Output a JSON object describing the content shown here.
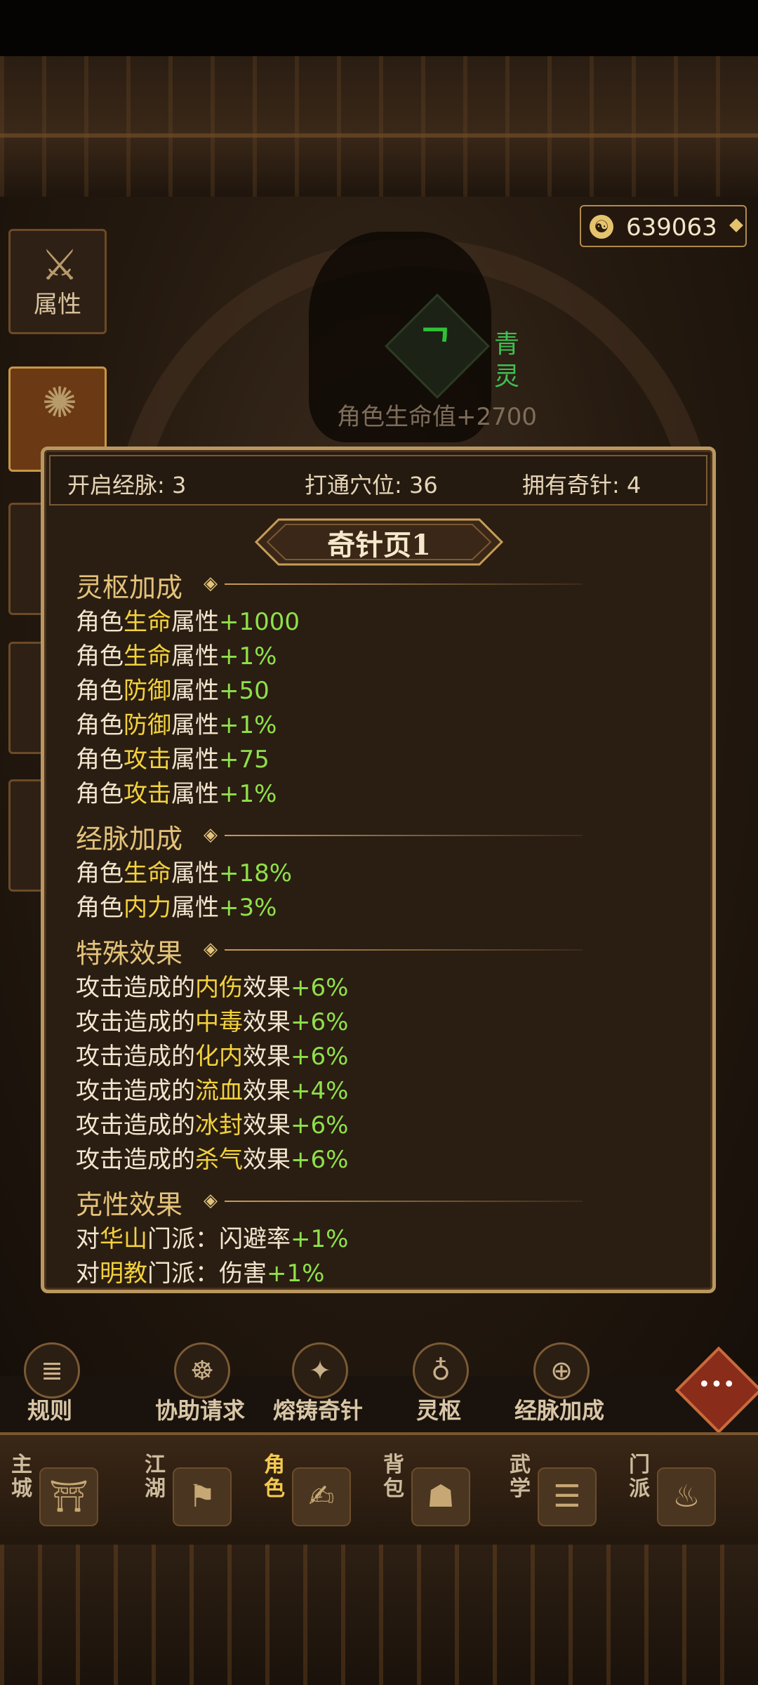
{
  "currency": {
    "amount": "639063",
    "icon": "yin-yang-coin-icon"
  },
  "side_tabs": [
    {
      "label": "属性",
      "icon": "attribute-sword-icon",
      "active": false
    },
    {
      "label": "",
      "icon": "meridian-figure-icon",
      "active": true
    },
    {
      "label": "",
      "icon": "tab-icon",
      "active": false
    },
    {
      "label": "",
      "icon": "tab-icon",
      "active": false
    },
    {
      "label": "",
      "icon": "tab-icon",
      "active": false
    }
  ],
  "header": {
    "logo_glyph": "ᄀ",
    "name": "青灵",
    "bonus": "角色生命值+2700"
  },
  "stats": {
    "meridians": "开启经脉: 3",
    "acupoints": "打通穴位: 36",
    "needles": "拥有奇针: 4"
  },
  "page_title": "奇针页1",
  "sections": {
    "lingshu": {
      "title": "灵枢加成",
      "lines": [
        {
          "pre": "角色",
          "hl": "生命",
          "mid": "属性",
          "val": "+1000"
        },
        {
          "pre": "角色",
          "hl": "生命",
          "mid": "属性",
          "val": "+1%"
        },
        {
          "pre": "角色",
          "hl": "防御",
          "mid": "属性",
          "val": "+50"
        },
        {
          "pre": "角色",
          "hl": "防御",
          "mid": "属性",
          "val": "+1%"
        },
        {
          "pre": "角色",
          "hl": "攻击",
          "mid": "属性",
          "val": "+75"
        },
        {
          "pre": "角色",
          "hl": "攻击",
          "mid": "属性",
          "val": "+1%"
        }
      ]
    },
    "jingmai": {
      "title": "经脉加成",
      "lines": [
        {
          "pre": "角色",
          "hl": "生命",
          "mid": "属性",
          "val": "+18%"
        },
        {
          "pre": "角色",
          "hl": "内力",
          "mid": "属性",
          "val": "+3%"
        }
      ]
    },
    "special": {
      "title": "特殊效果",
      "lines": [
        {
          "pre": "攻击造成的",
          "hl": "内伤",
          "mid": "效果",
          "val": "+6%"
        },
        {
          "pre": "攻击造成的",
          "hl": "中毒",
          "mid": "效果",
          "val": "+6%"
        },
        {
          "pre": "攻击造成的",
          "hl": "化内",
          "mid": "效果",
          "val": "+6%"
        },
        {
          "pre": "攻击造成的",
          "hl": "流血",
          "mid": "效果",
          "val": "+4%"
        },
        {
          "pre": "攻击造成的",
          "hl": "冰封",
          "mid": "效果",
          "val": "+6%"
        },
        {
          "pre": "攻击造成的",
          "hl": "杀气",
          "mid": "效果",
          "val": "+6%"
        }
      ]
    },
    "counter": {
      "title": "克性效果",
      "lines": [
        {
          "pre": "对",
          "hl": "华山",
          "mid": "门派：闪避率",
          "val": "+1%"
        },
        {
          "pre": "对",
          "hl": "明教",
          "mid": "门派：伤害",
          "val": "+1%"
        }
      ]
    }
  },
  "func_buttons": [
    {
      "label": "规则",
      "icon": "scroll-icon"
    },
    {
      "label": "协助请求",
      "icon": "help-figure-icon"
    },
    {
      "label": "熔铸奇针",
      "icon": "forge-icon"
    },
    {
      "label": "灵枢",
      "icon": "lingshu-icon"
    },
    {
      "label": "经脉加成",
      "icon": "meridian-bonus-icon"
    }
  ],
  "chat": {
    "icon": "chat-bubble-icon",
    "glyph": "•••"
  },
  "nav": [
    {
      "label": "主城",
      "icon": "palace-icon",
      "active": false
    },
    {
      "label": "江湖",
      "icon": "jianghu-icon",
      "active": false
    },
    {
      "label": "角色",
      "icon": "character-scroll-icon",
      "active": true
    },
    {
      "label": "背包",
      "icon": "bag-icon",
      "active": false
    },
    {
      "label": "武学",
      "icon": "martial-arts-icon",
      "active": false
    },
    {
      "label": "门派",
      "icon": "sect-cauldron-icon",
      "active": false
    }
  ]
}
